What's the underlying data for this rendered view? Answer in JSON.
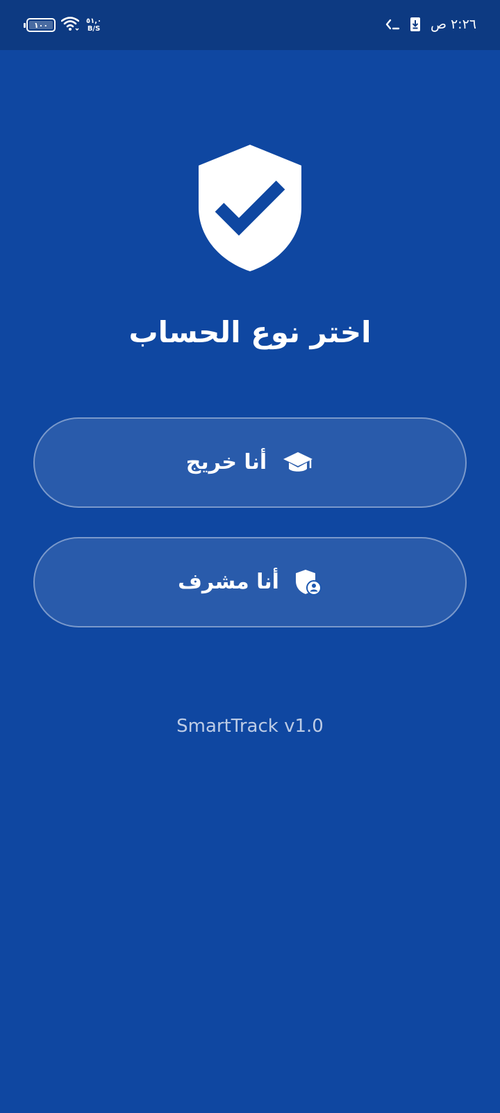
{
  "status_bar": {
    "battery_level": "١٠٠",
    "net_speed_value": "٥١,٠",
    "net_speed_unit": "B/S",
    "time": "٢:٢٦ ص",
    "icons": [
      "battery-icon",
      "wifi-icon",
      "download-notification-icon",
      "terminal-icon"
    ]
  },
  "main": {
    "title": "اختر نوع الحساب",
    "hero_icon": "shield-check-icon",
    "buttons": [
      {
        "label": "أنا خريج",
        "icon": "graduation-cap-icon"
      },
      {
        "label": "أنا مشرف",
        "icon": "admin-shield-icon"
      }
    ]
  },
  "footer": {
    "version": "SmartTrack v1.0"
  },
  "colors": {
    "background": "#0f47a1",
    "status_bar": "#0d3a82",
    "foreground": "#ffffff"
  }
}
